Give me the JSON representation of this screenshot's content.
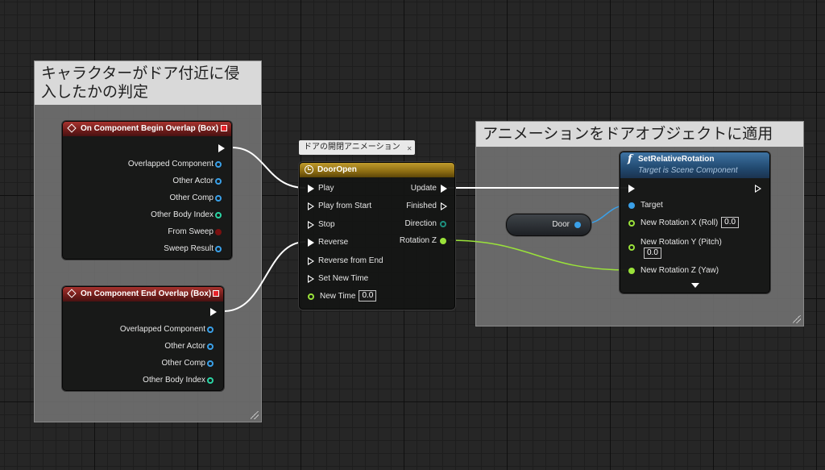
{
  "comments": {
    "detect": "キャラクターがドア付近に侵\n入したかの判定",
    "apply": "アニメーションをドアオブジェクトに適用"
  },
  "begin_overlap": {
    "title": "On Component Begin Overlap (Box)",
    "pins": [
      "Overlapped Component",
      "Other Actor",
      "Other Comp",
      "Other Body Index",
      "From Sweep",
      "Sweep Result"
    ]
  },
  "end_overlap": {
    "title": "On Component End Overlap (Box)",
    "pins": [
      "Overlapped Component",
      "Other Actor",
      "Other Comp",
      "Other Body Index"
    ]
  },
  "timeline": {
    "tooltip": "ドアの開閉アニメーション",
    "title": "DoorOpen",
    "inputs": [
      "Play",
      "Play from Start",
      "Stop",
      "Reverse",
      "Reverse from End",
      "Set New Time"
    ],
    "new_time_label": "New Time",
    "new_time_value": "0.0",
    "outputs": [
      "Update",
      "Finished",
      "Direction",
      "Rotation Z"
    ]
  },
  "door_var": {
    "label": "Door"
  },
  "set_rotation": {
    "title": "SetRelativeRotation",
    "subtitle": "Target is Scene Component",
    "target_label": "Target",
    "roll_label": "New Rotation X (Roll)",
    "roll_value": "0.0",
    "pitch_label": "New Rotation Y (Pitch)",
    "pitch_value": "0.0",
    "yaw_label": "New Rotation Z (Yaw)"
  },
  "colors": {
    "event_header": "#a8332f",
    "timeline_header": "#bf9a2c",
    "function_header": "#3e73a3",
    "object_pin": "#3aa0e8",
    "int_pin": "#2bd4a4",
    "bool_pin": "#7a1010",
    "float_pin": "#9ae23a"
  }
}
